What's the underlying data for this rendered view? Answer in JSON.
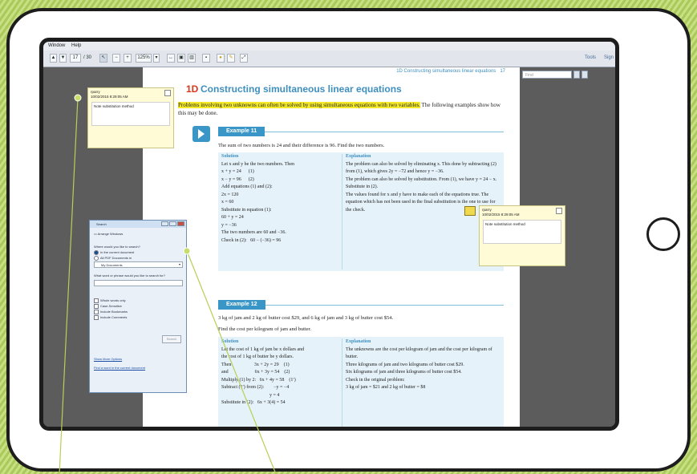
{
  "menu": [
    "Window",
    "Help"
  ],
  "toolbar": {
    "page_current": "17",
    "page_total": "/ 30",
    "zoom": "125%",
    "tools_label": "Tools",
    "sign_label": "Sign",
    "find_placeholder": "Find"
  },
  "page": {
    "running_head": "1D Constructing simultaneous linear equations",
    "page_number": "17",
    "section_number": "1D",
    "section_title": "Constructing simultaneous linear equations",
    "outcome_tag": "Outcomes",
    "intro_highlight": "Problems involving two unknowns can often be solved by using simultaneous equations with two variables.",
    "intro_rest": " The following examples show how this may be done."
  },
  "example11": {
    "label": "Example 11",
    "stem": "The sum of two numbers is 24 and their difference is 96. Find the two numbers.",
    "solution_head": "Solution",
    "explanation_head": "Explanation",
    "solution_lines": [
      "Let x and y be the two numbers. Then",
      "x + y = 24      (1)",
      "x − y = 96      (2)",
      "Add equations (1) and (2):",
      "2x = 120",
      "x = 60",
      "Substitute in equation (1):",
      "60 + y = 24",
      "y = −36",
      "The two numbers are 60 and −36.",
      "Check in (2):   60 − (−36) = 96"
    ],
    "explanation_paras": [
      "The problem can also be solved by eliminating x. This done by subtracting (2) from (1), which gives 2y = −72 and hence y = −36.",
      "The problem can also be solved by substitution. From (1), we have y = 24 − x. Substitute in (2).",
      "The values found for x and y have to make each of the equations true. The equation which has not been used in the final substitution is the one to use for the check."
    ]
  },
  "example12": {
    "label": "Example 12",
    "stem1": "3 kg of jam and 2 kg of butter cost $29, and 6 kg of jam and 3 kg of butter cost $54.",
    "stem2": "Find the cost per kilogram of jam and butter.",
    "solution_head": "Solution",
    "explanation_head": "Explanation",
    "solution_lines": [
      "Let the cost of 1 kg of jam be x dollars and",
      "the cost of 1 kg of butter be y dollars.",
      "Then                   3x + 2y = 29    (1)",
      "and                      6x + 3y = 54    (2)",
      "Multiply (1) by 2:   6x + 4y = 58    (1′)",
      "Subtract (1′) from (2):        −y = −4",
      "                                        y = 4",
      "Substitute in (2):   6x + 3(4) = 54"
    ],
    "explanation_paras": [
      "The unknowns are the cost per kilogram of jam and the cost per kilogram of butter.",
      "Three kilograms of jam and two kilograms of butter cost $29.",
      "Six kilograms of jam and three kilograms of butter cost $54.",
      "Check in the original problem:",
      "3 kg of jam = $21 and 2 kg of butter = $8"
    ]
  },
  "note_left": {
    "author": "rparry",
    "date": "10/02/2015 8:29:05 AM",
    "text": "Note substitution method"
  },
  "note_right": {
    "author": "rparry",
    "date": "10/02/2015 8:29:05 AM",
    "text": "Note substitution method"
  },
  "search": {
    "title": "Search",
    "arrange": "Arrange Windows",
    "where_label": "Where would you like to search?",
    "opt_current": "In the current document",
    "opt_all": "All PDF Documents in",
    "folder": "My Documents",
    "what_label": "What word or phrase would you like to search for?",
    "checks": [
      "Whole words only",
      "Case-Sensitive",
      "Include Bookmarks",
      "Include Comments"
    ],
    "search_button": "Search",
    "more_options": "Show More Options",
    "find_word": "Find a word in the current document"
  },
  "colors": {
    "accent_blue": "#3e8fbf",
    "section_red": "#d9371d",
    "highlight": "#f4ea2a",
    "background_green": "#b9d36a"
  }
}
